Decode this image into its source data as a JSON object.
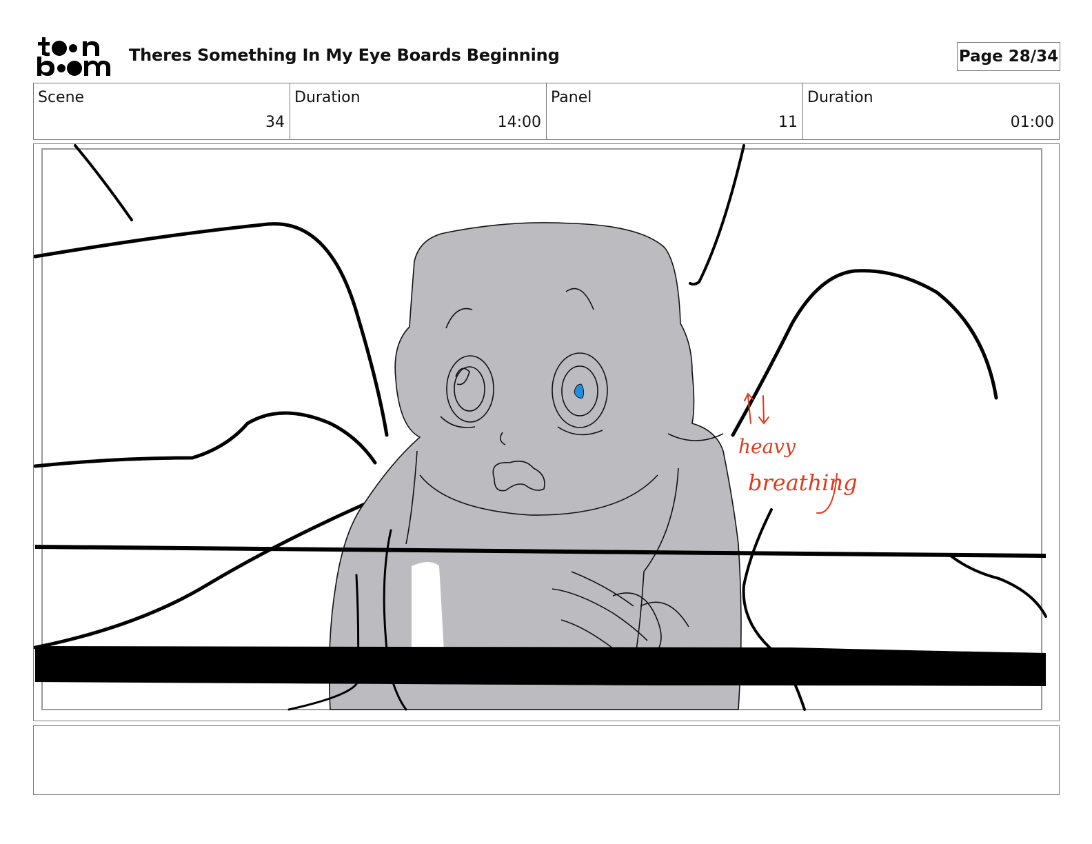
{
  "header": {
    "logo_text": "toon boom",
    "document_title": "Theres Something In My Eye Boards Beginning",
    "page_indicator": "Page 28/34"
  },
  "info_bar": {
    "scene_label": "Scene",
    "scene_value": "34",
    "scene_duration_label": "Duration",
    "scene_duration_value": "14:00",
    "panel_label": "Panel",
    "panel_value": "11",
    "panel_duration_label": "Duration",
    "panel_duration_value": "01:00"
  },
  "panel": {
    "annotation_line1": "heavy",
    "annotation_line2": "breathing",
    "annotation_color": "#e0391c",
    "character_fill": "#bcbcc0",
    "eye_highlight_color": "#1e8fe0"
  },
  "notes": {
    "text": ""
  }
}
